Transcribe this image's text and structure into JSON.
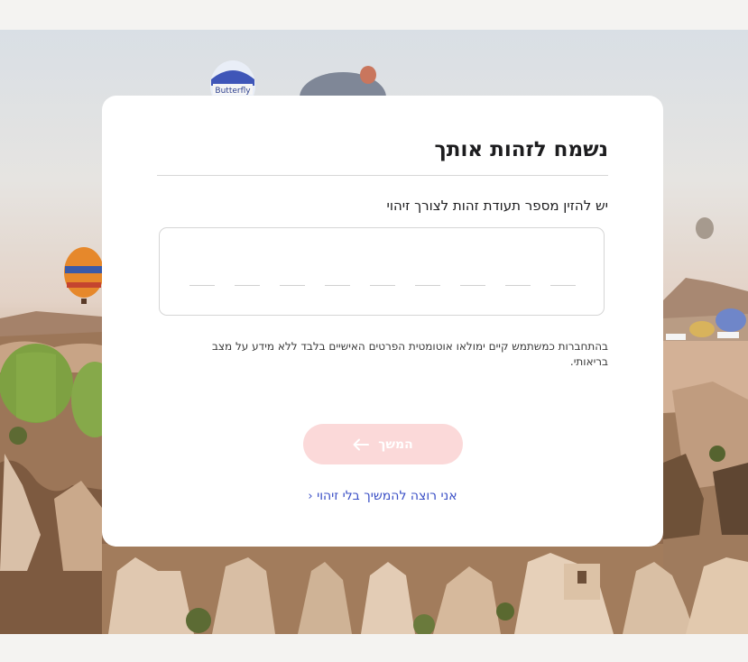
{
  "hero": {
    "balloon_text": "Butterfly",
    "colors": {
      "card": "#ffffff",
      "button_disabled": "#fbd9d9",
      "link": "#3a4fc6"
    }
  },
  "form": {
    "title": "נשמח לזהות אותך",
    "id_label": "יש להזין מספר תעודת זהות לצורך זיהוי",
    "digit_count": 9,
    "note": "בהתחברות כמשתמש קיים ימולאו אוטומטית הפרטים האישיים בלבד ללא מידע על מצב בריאותי.",
    "continue_label": "המשך",
    "continue_icon": "arrow-left-icon",
    "skip_label": "אני רוצה להמשיך בלי זיהוי",
    "skip_icon": "chevron-left-icon"
  }
}
